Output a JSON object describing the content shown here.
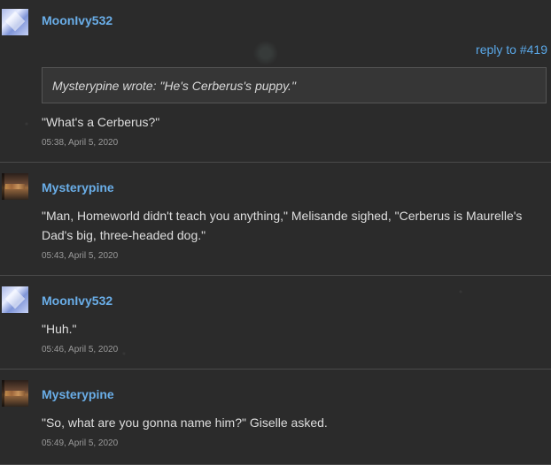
{
  "posts": [
    {
      "username": "MoonIvy532",
      "avatar_icon": "moon-diamond-avatar",
      "reply_link": "reply to #419",
      "quote": "Mysterypine wrote: \"He's Cerberus's puppy.\"",
      "text": "\"What's a Cerberus?\"",
      "time": "05:38, April 5, 2020"
    },
    {
      "username": "Mysterypine",
      "avatar_icon": "castle-avatar",
      "text": "\"Man, Homeworld didn't teach you anything,\" Melisande sighed, \"Cerberus is Maurelle's Dad's big, three-headed dog.\"",
      "time": "05:43, April 5, 2020"
    },
    {
      "username": "MoonIvy532",
      "avatar_icon": "moon-diamond-avatar",
      "text": "\"Huh.\"",
      "time": "05:46, April 5, 2020"
    },
    {
      "username": "Mysterypine",
      "avatar_icon": "castle-avatar",
      "text": "\"So, what are you gonna name him?\" Giselle asked.",
      "time": "05:49, April 5, 2020"
    }
  ],
  "colors": {
    "background": "#2b2b2b",
    "username": "#6aaee8",
    "link": "#5aa8e8",
    "timestamp": "#9a9a9a"
  }
}
